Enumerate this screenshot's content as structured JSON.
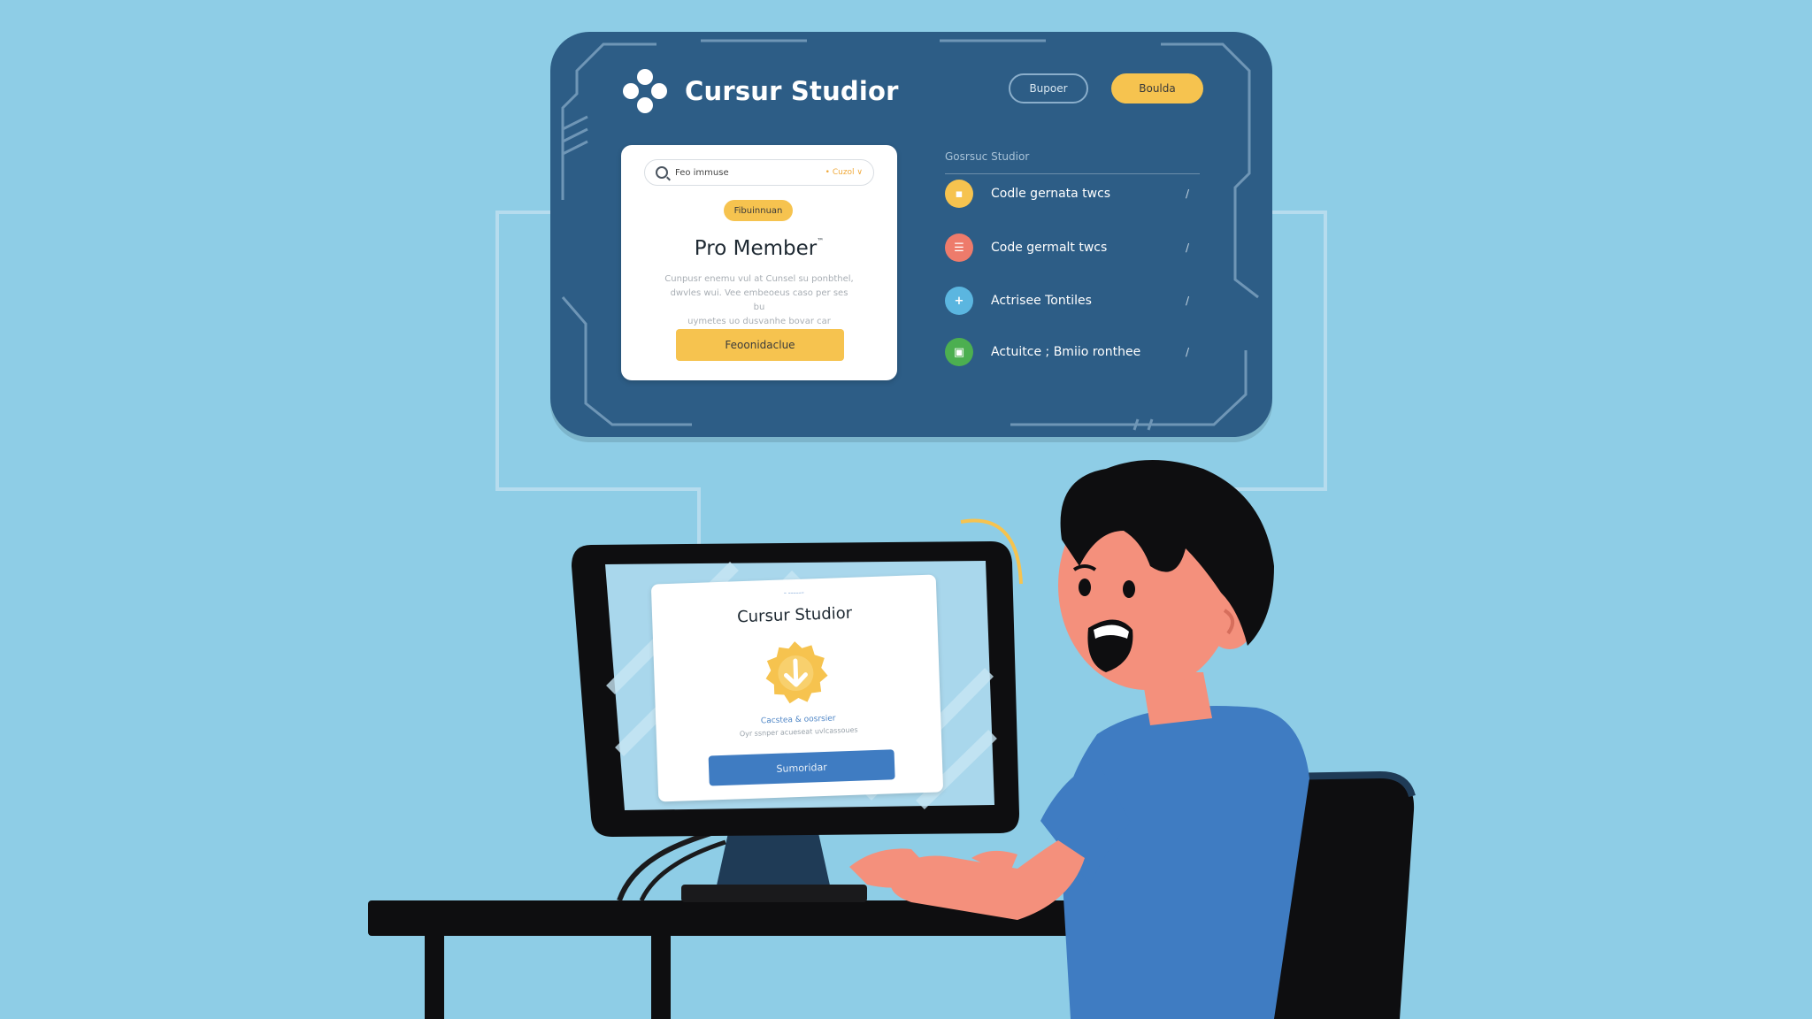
{
  "dashboard": {
    "brand_title": "Cursur Studior",
    "header_buttons": {
      "outline_label": "Bupoer",
      "primary_label": "Boulda"
    },
    "search": {
      "placeholder_value": "Feo immuse",
      "filter_label": "• Cuzol ∨"
    },
    "card": {
      "badge": "Fibuinnuan",
      "title": "Pro Member",
      "title_mark": "™",
      "description": [
        "Cunpusr enemu vul at Cunsel su ponbthel,",
        "dwvles wui. Vee embeoeus caso per ses bu",
        "uymetes uo dusvanhe bovar car gornuduse"
      ],
      "button_label": "Feoonidaclue"
    },
    "list": {
      "header": "Gosrsuc Studior",
      "items": [
        {
          "label": "Codle gernata twcs",
          "icon": "doc-icon",
          "color": "#f6c34f",
          "glyph": "▪"
        },
        {
          "label": "Code germalt twcs",
          "icon": "list-icon",
          "color": "#ee7b6b",
          "glyph": "☰"
        },
        {
          "label": "Actrisee Tontiles",
          "icon": "plus-icon",
          "color": "#5bb6e0",
          "glyph": "+"
        },
        {
          "label": "Actuitce ; Bmiio ronthee",
          "icon": "check-square-icon",
          "color": "#4caf50",
          "glyph": "▣"
        }
      ],
      "edit_glyph": "/"
    }
  },
  "monitor": {
    "small_label": "– ––––––",
    "title": "Cursur Studior",
    "status": "Cacstea & oosrsier",
    "subtext": "Oyr ssnper acueseat uvlcassoues",
    "button_label": "Sumoridar"
  },
  "colors": {
    "background": "#8ecde6",
    "panel": "#2d5d86",
    "accent_yellow": "#f6c34f",
    "accent_blue": "#3f7cc2"
  }
}
